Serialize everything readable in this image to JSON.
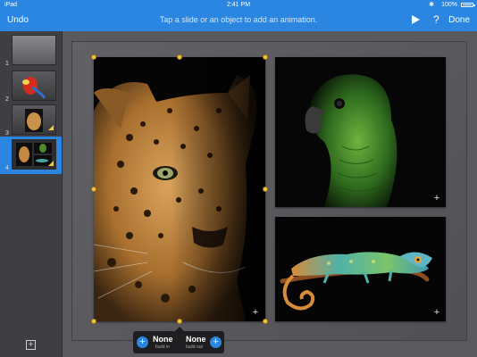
{
  "status_bar": {
    "device": "iPad",
    "time": "2:41 PM",
    "battery": "100%"
  },
  "toolbar": {
    "undo_label": "Undo",
    "hint": "Tap a slide or an object to add an animation.",
    "play_icon": "play-icon",
    "help_label": "?",
    "done_label": "Done",
    "accent": "#2a86e0"
  },
  "sidebar": {
    "slides": [
      {
        "number": "1",
        "selected": false
      },
      {
        "number": "2",
        "selected": false
      },
      {
        "number": "3",
        "selected": false
      },
      {
        "number": "4",
        "selected": true
      }
    ],
    "add_label": "+"
  },
  "build_popup": {
    "in_value": "None",
    "in_caption": "build in",
    "out_value": "None",
    "out_caption": "build out"
  },
  "icons": {
    "plus": "+",
    "handle_color": "#f2c53d"
  }
}
